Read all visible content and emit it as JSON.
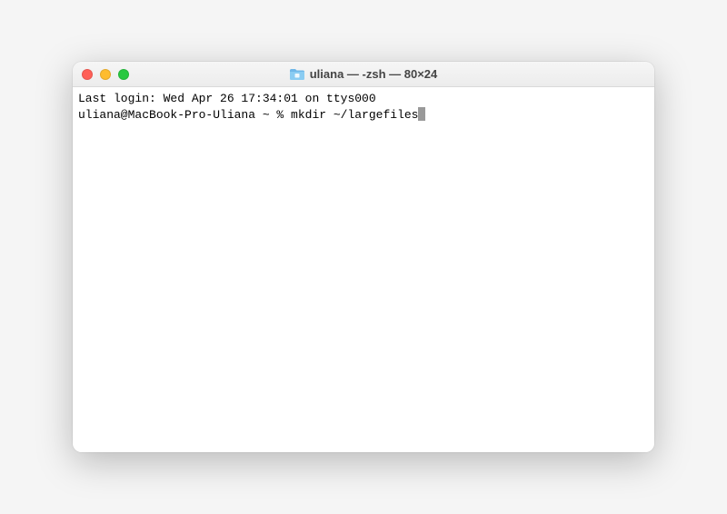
{
  "window": {
    "title": "uliana — -zsh — 80×24"
  },
  "terminal": {
    "last_login": "Last login: Wed Apr 26 17:34:01 on ttys000",
    "prompt": "uliana@MacBook-Pro-Uliana ~ % ",
    "command": "mkdir ~/largefiles"
  },
  "colors": {
    "close": "#ff5f57",
    "minimize": "#febc2e",
    "maximize": "#28c840"
  }
}
